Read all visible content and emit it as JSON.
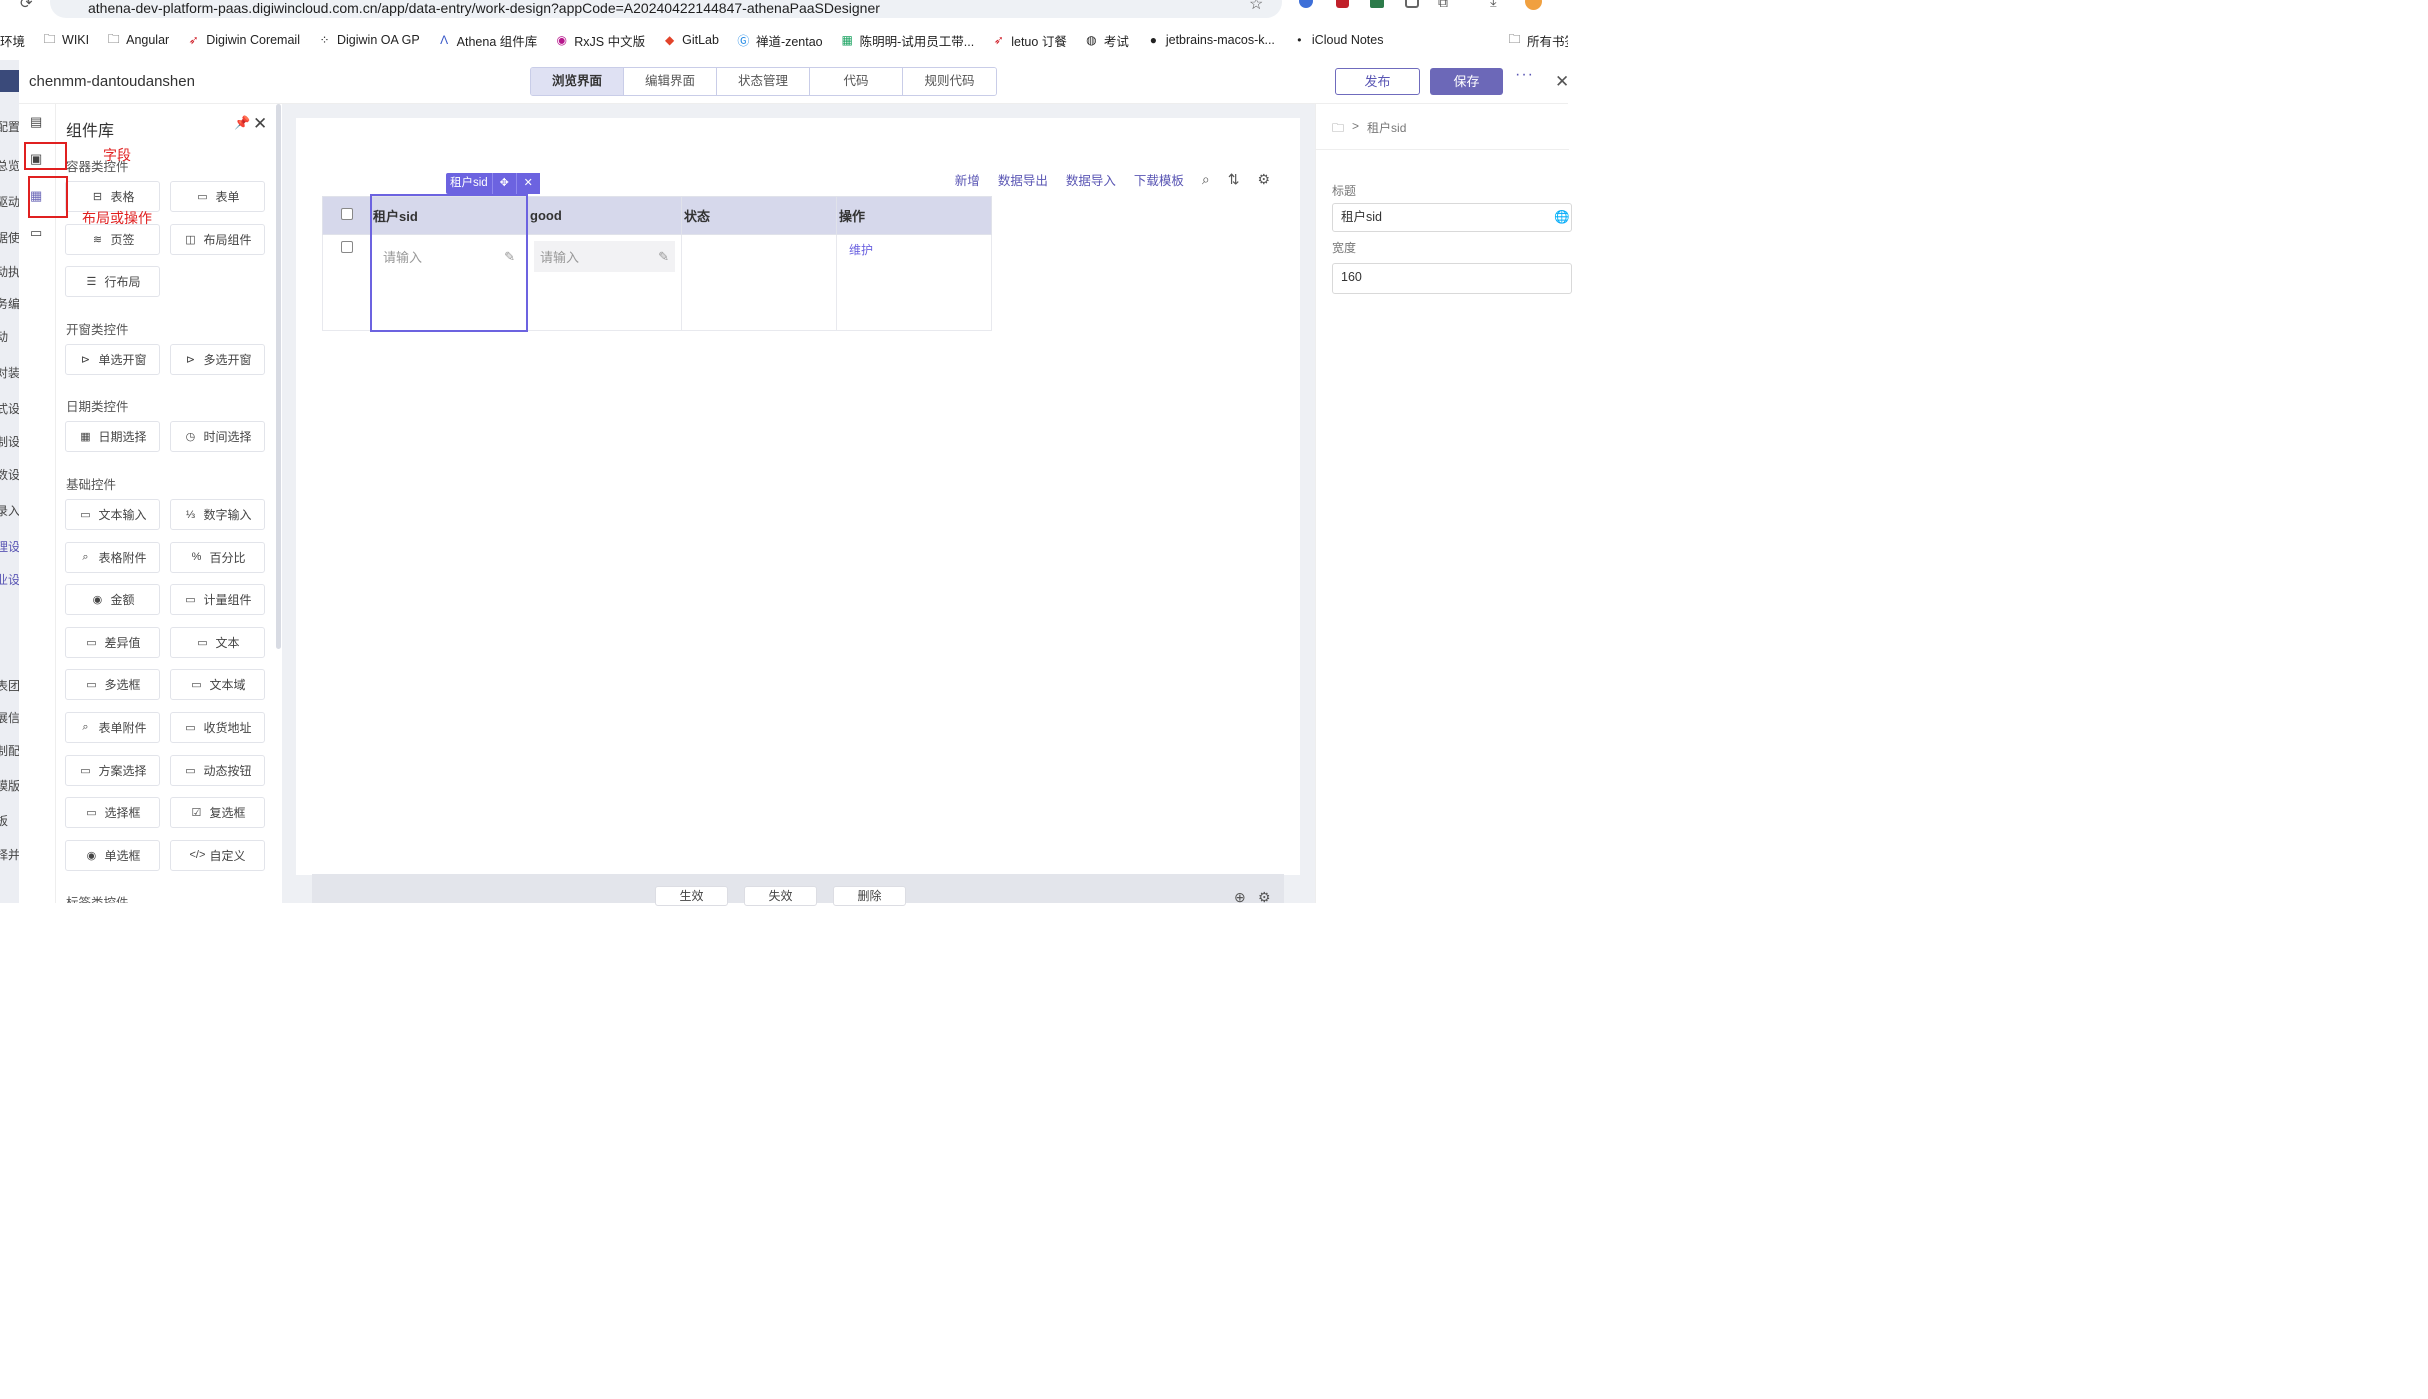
{
  "browser": {
    "url": "athena-dev-platform-paas.digiwincloud.com.cn/app/data-entry/work-design?appCode=A20240422144847-athenaPaaSDesigner",
    "bookmarks": [
      {
        "label": "环境",
        "icon": "folder-icon"
      },
      {
        "label": "WIKI",
        "icon": "folder-icon"
      },
      {
        "label": "Angular",
        "icon": "folder-icon"
      },
      {
        "label": "Digiwin Coremail",
        "icon": "bird-icon"
      },
      {
        "label": "Digiwin OA GP",
        "icon": "spinner-icon"
      },
      {
        "label": "Athena 组件库",
        "icon": "athena-icon"
      },
      {
        "label": "RxJS 中文版",
        "icon": "rxjs-icon"
      },
      {
        "label": "GitLab",
        "icon": "gitlab-icon"
      },
      {
        "label": "禅道-zentao",
        "icon": "zentao-icon"
      },
      {
        "label": "陈明明-试用员工带...",
        "icon": "sheet-icon"
      },
      {
        "label": "letuo 订餐",
        "icon": "bird-icon"
      },
      {
        "label": "考试",
        "icon": "globe-icon"
      },
      {
        "label": "jetbrains-macos-k...",
        "icon": "github-icon"
      },
      {
        "label": "iCloud Notes",
        "icon": "apple-icon"
      }
    ],
    "all_bookmarks": "所有书签"
  },
  "header": {
    "project": "chenmm-dantoudanshen",
    "tabs": [
      "浏览界面",
      "编辑界面",
      "状态管理",
      "代码",
      "规则代码"
    ],
    "active_tab": 0,
    "publish": "发布",
    "save": "保存",
    "more": "···"
  },
  "left_edge": [
    "配置",
    "总览",
    "驱动",
    "据使",
    "动执",
    "务编",
    "动",
    "对装",
    "式设",
    "制设",
    "数设",
    "录入",
    "理设",
    "业设",
    "表团",
    "展信",
    "制配",
    "模版",
    "板",
    "择并"
  ],
  "panel": {
    "title": "组件库",
    "sections": [
      {
        "title": "容器类控件",
        "items": [
          {
            "label": "表格",
            "icon": "table-icon"
          },
          {
            "label": "表单",
            "icon": "form-icon"
          },
          {
            "label": "页签",
            "icon": "layers-icon"
          },
          {
            "label": "布局组件",
            "icon": "layout-icon"
          },
          {
            "label": "行布局",
            "icon": "row-layout-icon"
          }
        ]
      },
      {
        "title": "开窗类控件",
        "items": [
          {
            "label": "单选开窗",
            "icon": "window-icon"
          },
          {
            "label": "多选开窗",
            "icon": "window-icon"
          }
        ]
      },
      {
        "title": "日期类控件",
        "items": [
          {
            "label": "日期选择",
            "icon": "calendar-icon"
          },
          {
            "label": "时间选择",
            "icon": "clock-icon"
          }
        ]
      },
      {
        "title": "基础控件",
        "items": [
          {
            "label": "文本输入",
            "icon": "input-icon"
          },
          {
            "label": "数字输入",
            "icon": "number-icon"
          },
          {
            "label": "表格附件",
            "icon": "attachment-icon"
          },
          {
            "label": "百分比",
            "icon": "percent-icon"
          },
          {
            "label": "金额",
            "icon": "coin-icon"
          },
          {
            "label": "计量组件",
            "icon": "input-icon"
          },
          {
            "label": "差异值",
            "icon": "input-icon"
          },
          {
            "label": "文本",
            "icon": "input-icon"
          },
          {
            "label": "多选框",
            "icon": "input-icon"
          },
          {
            "label": "文本域",
            "icon": "input-icon"
          },
          {
            "label": "表单附件",
            "icon": "attachment-icon"
          },
          {
            "label": "收货地址",
            "icon": "input-icon"
          },
          {
            "label": "方案选择",
            "icon": "select-icon"
          },
          {
            "label": "动态按钮",
            "icon": "input-icon"
          },
          {
            "label": "选择框",
            "icon": "select-icon"
          },
          {
            "label": "复选框",
            "icon": "checkbox-icon"
          },
          {
            "label": "单选框",
            "icon": "radio-icon"
          },
          {
            "label": "自定义",
            "icon": "code-icon"
          }
        ]
      },
      {
        "title": "标签类控件",
        "items": []
      }
    ]
  },
  "annotations": {
    "field": "字段",
    "layout": "布局或操作"
  },
  "toolbar": {
    "add": "新增",
    "export": "数据导出",
    "import": "数据导入",
    "template": "下载模板"
  },
  "table": {
    "columns": [
      "租户sid",
      "good",
      "状态",
      "操作"
    ],
    "placeholder": "请输入",
    "action_link": "维护",
    "selected_tag": "租户sid"
  },
  "bottom": [
    "生效",
    "失效",
    "删除"
  ],
  "right": {
    "breadcrumb": "租户sid",
    "title_label": "标题",
    "title_value": "租户sid",
    "width_label": "宽度",
    "width_value": "160"
  }
}
